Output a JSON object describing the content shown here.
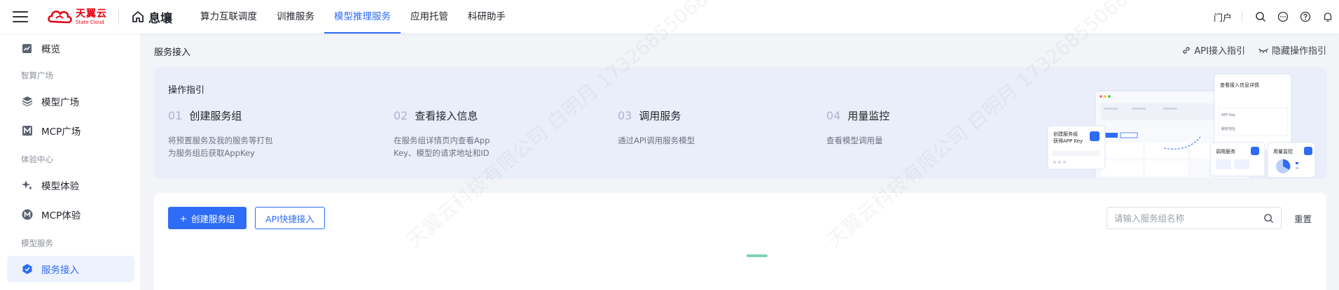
{
  "topbar": {
    "logo_cn": "天翼云",
    "logo_en": "State Cloud",
    "brand": "息壤",
    "nav": [
      {
        "label": "算力互联调度",
        "active": false
      },
      {
        "label": "训推服务",
        "active": false
      },
      {
        "label": "模型推理服务",
        "active": true
      },
      {
        "label": "应用托管",
        "active": false
      },
      {
        "label": "科研助手",
        "active": false
      }
    ],
    "portal": "门户",
    "icons": [
      "search-icon",
      "more-icon",
      "help-icon",
      "bell-icon"
    ]
  },
  "sidebar": {
    "items": [
      {
        "label": "概览",
        "icon": "chart-icon",
        "active": false
      },
      {
        "label": "模型广场",
        "icon": "cube-icon",
        "active": false
      },
      {
        "label": "MCP广场",
        "icon": "mcp-icon",
        "active": false
      },
      {
        "label": "模型体验",
        "icon": "sparkle-icon",
        "active": false
      },
      {
        "label": "MCP体验",
        "icon": "mcp-circle-icon",
        "active": false
      },
      {
        "label": "服务接入",
        "icon": "service-icon",
        "active": true
      }
    ],
    "groups": [
      "智算广场",
      "体验中心",
      "模型服务"
    ]
  },
  "content": {
    "breadcrumb": "服务接入",
    "api_guide_link": "API接入指引",
    "hide_guide_link": "隐藏操作指引",
    "guide": {
      "title": "操作指引",
      "steps": [
        {
          "num": "01",
          "title": "创建服务组",
          "desc": "将预置服务及我的服务等打包为服务组后获取AppKey"
        },
        {
          "num": "02",
          "title": "查看接入信息",
          "desc": "在服务组详情页内查看App Key、模型的请求地址和ID"
        },
        {
          "num": "03",
          "title": "调用服务",
          "desc": "通过API调用服务模型"
        },
        {
          "num": "04",
          "title": "用量监控",
          "desc": "查看模型调用量"
        }
      ],
      "illustration": {
        "card_create_line1": "创建服务组",
        "card_create_line2": "获得APP Key",
        "card_detail_title": "查看接入信息详情",
        "card_detail_row1": "APP Key",
        "card_detail_row2": "服务地址",
        "card_call": "调用服务",
        "card_usage": "用量监控"
      }
    },
    "create_button": "创建服务组",
    "api_quick_button": "API快捷接入",
    "search_placeholder": "请输入服务组名称",
    "reset_button": "重置"
  },
  "watermark": "天翼云科技有限公司 白明月 17326855068",
  "colors": {
    "accent": "#2e6cf6",
    "brand_red": "#e60012"
  }
}
